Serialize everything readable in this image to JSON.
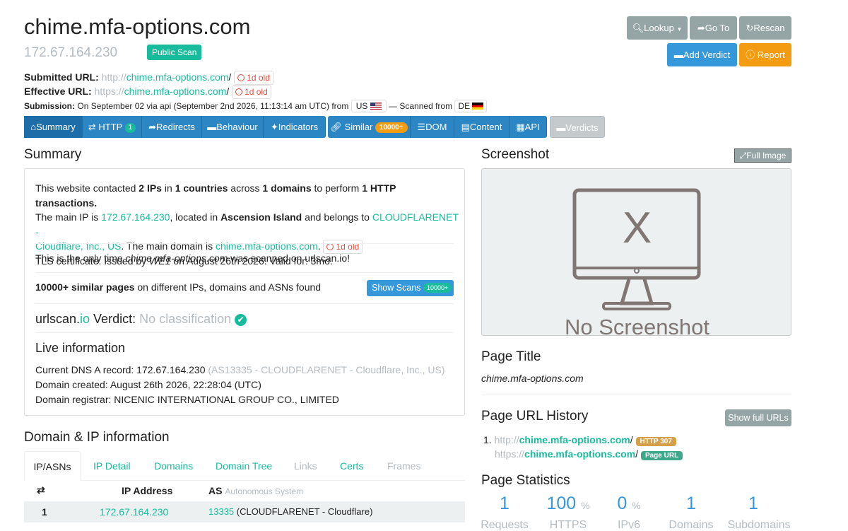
{
  "header": {
    "domain": "chime.mfa-options.com",
    "ip": "172.67.164.230",
    "public_scan_badge": "Public Scan"
  },
  "top_buttons": {
    "lookup": "Lookup",
    "goto": "Go To",
    "rescan": "Rescan",
    "add_verdict": "Add Verdict",
    "report": "Report"
  },
  "urls": {
    "submitted_label": "Submitted URL:",
    "submitted_scheme": "http://",
    "submitted_host": "chime.mfa-options.com",
    "submitted_path": "/",
    "submitted_age": "1d old",
    "effective_label": "Effective URL:",
    "effective_scheme": "https://",
    "effective_host": "chime.mfa-options.com",
    "effective_path": "/",
    "effective_age": "1d old",
    "submission_label": "Submission:",
    "submission_text": "On September 02 via api (September 2nd 2026, 11:13:14 am UTC) from",
    "from_country": "US",
    "scanned_from_text": "— Scanned from",
    "scanned_country": "DE"
  },
  "tabs": [
    {
      "label": "Summary"
    },
    {
      "label": "HTTP",
      "badge": "1"
    },
    {
      "label": "Redirects"
    },
    {
      "label": "Behaviour"
    },
    {
      "label": "Indicators"
    },
    {
      "label": "Similar",
      "badge": "10000+"
    },
    {
      "label": "DOM"
    },
    {
      "label": "Content"
    },
    {
      "label": "API"
    },
    {
      "label": "Verdicts"
    }
  ],
  "summary": {
    "title": "Summary",
    "p1_a": "This website contacted ",
    "p1_ips": "2 IPs",
    "p1_b": " in ",
    "p1_countries": "1 countries",
    "p1_c": " across ",
    "p1_domains": "1 domains",
    "p1_d": " to perform ",
    "p1_tx": "1 HTTP transactions.",
    "p2_a": "The main IP is ",
    "p2_ip": "172.67.164.230",
    "p2_b": ", located in ",
    "p2_loc": "Ascension Island",
    "p2_c": " and belongs to ",
    "p2_asn1": "CLOUDFLARENET -",
    "p2_asn2": "Cloudflare, Inc., US",
    "p2_d": ". The main domain is ",
    "p2_domain": "chime.mfa-options.com",
    "p2_e": ".",
    "p2_age": "1d old",
    "p3_a": "TLS certificate: Issued by ",
    "p3_issuer": "WE1",
    "p3_b": " on August 26th 2026. Valid for: 3mo.",
    "only_a": "This is the only time ",
    "only_domain": "chime.mfa-options.com",
    "only_b": " was scanned on urlscan.io!",
    "similar_bold": "10000+ similar pages",
    "similar_rest": " on different IPs, domains and ASNs found",
    "show_scans": "Show Scans",
    "show_scans_badge": "10000+",
    "verdict_a": "urlscan.",
    "verdict_io": "io",
    "verdict_b": " Verdict: ",
    "verdict_value": "No classification",
    "live_title": "Live information",
    "dns_a": "Current DNS A record: 172.67.164.230 ",
    "dns_asn": "(AS13335 - CLOUDFLARENET - Cloudflare, Inc., US)",
    "created": "Domain created: August 26th 2026, 22:28:04 (UTC)",
    "registrar": "Domain registrar: NICENIC INTERNATIONAL GROUP CO., LIMITED"
  },
  "domain_ip": {
    "title": "Domain & IP information",
    "tabs": [
      "IP/ASNs",
      "IP Detail",
      "Domains",
      "Domain Tree",
      "Links",
      "Certs",
      "Frames"
    ],
    "col_ip": "IP Address",
    "col_as": "AS",
    "col_as_sub": "Autonomous System",
    "rows": [
      {
        "n": "1",
        "ip": "172.67.164.230",
        "asn": "13335",
        "as_name": "(CLOUDFLARENET - Cloudflare)"
      }
    ]
  },
  "screenshot": {
    "title": "Screenshot",
    "full_image": "Full Image",
    "placeholder_x": "X",
    "placeholder_text": "No Screenshot"
  },
  "page_title": {
    "title": "Page Title",
    "value": "chime.mfa-options.com"
  },
  "url_history": {
    "title": "Page URL History",
    "show_full": "Show full URLs",
    "item_num": "1.",
    "h1_scheme": "http://",
    "h1_host": "chime.mfa-options.com",
    "h1_path": "/",
    "h1_badge": "HTTP 307",
    "h2_scheme": "https://",
    "h2_host": "chime.mfa-options.com",
    "h2_path": "/",
    "h2_badge": "Page URL"
  },
  "stats": {
    "title": "Page Statistics",
    "items": [
      {
        "value": "1",
        "unit": "",
        "label": "Requests"
      },
      {
        "value": "100",
        "unit": "%",
        "label": "HTTPS"
      },
      {
        "value": "0",
        "unit": "%",
        "label": "IPv6"
      },
      {
        "value": "1",
        "unit": "",
        "label": "Domains"
      },
      {
        "value": "1",
        "unit": "",
        "label": "Subdomains"
      }
    ]
  },
  "colors": {
    "teal": "#18bc9c",
    "blue": "#3498db",
    "grey_btn": "#95a5a6",
    "orange": "#f39c12",
    "red": "#e74c3c"
  }
}
